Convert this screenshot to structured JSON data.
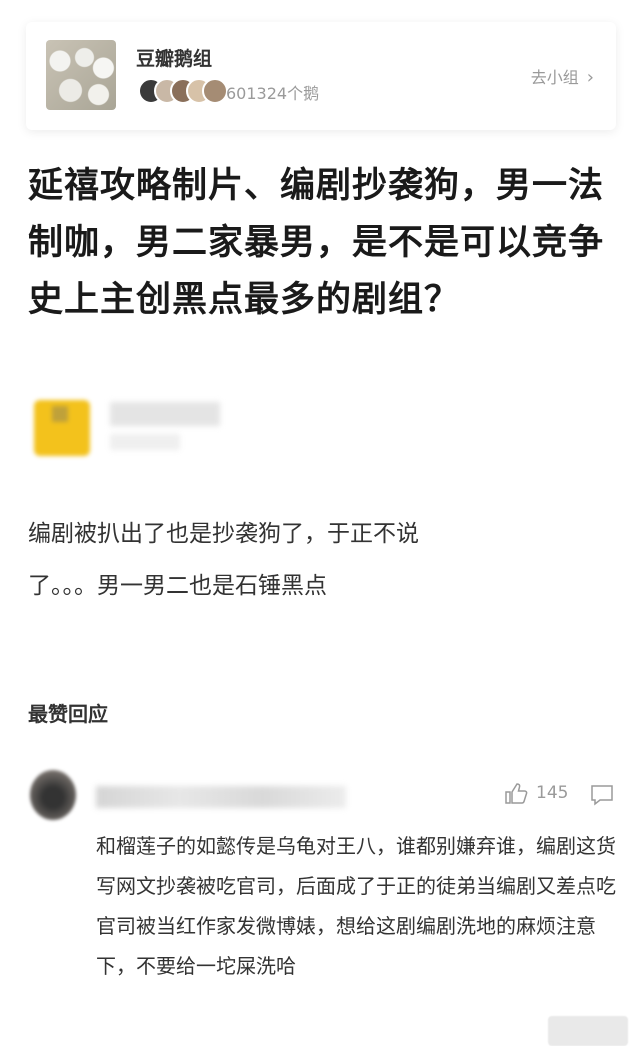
{
  "group": {
    "name": "豆瓣鹅组",
    "member_count": "601324个鹅",
    "goto_label": "去小组",
    "member_avatar_colors": [
      "#3a3a3a",
      "#c9b8a6",
      "#8a6f5a",
      "#d7c2a8",
      "#a58c74"
    ]
  },
  "post": {
    "title": "延禧攻略制片、编剧抄袭狗，男一法制咖，男二家暴男，是不是可以竞争史上主创黑点最多的剧组？",
    "body_line1": "编剧被扒出了也是抄袭狗了，于正不说",
    "body_line2": "了。。。男一男二也是石锤黑点"
  },
  "replies_section": {
    "title": "最赞回应"
  },
  "top_reply": {
    "likes": "145",
    "text": "和榴莲子的如懿传是乌龟对王八，谁都别嫌弃谁，编剧这货写网文抄袭被吃官司，后面成了于正的徒弟当编剧又差点吃官司被当红作家发微博婊，想给这剧编剧洗地的麻烦注意下，不要给一坨屎洗哈"
  }
}
